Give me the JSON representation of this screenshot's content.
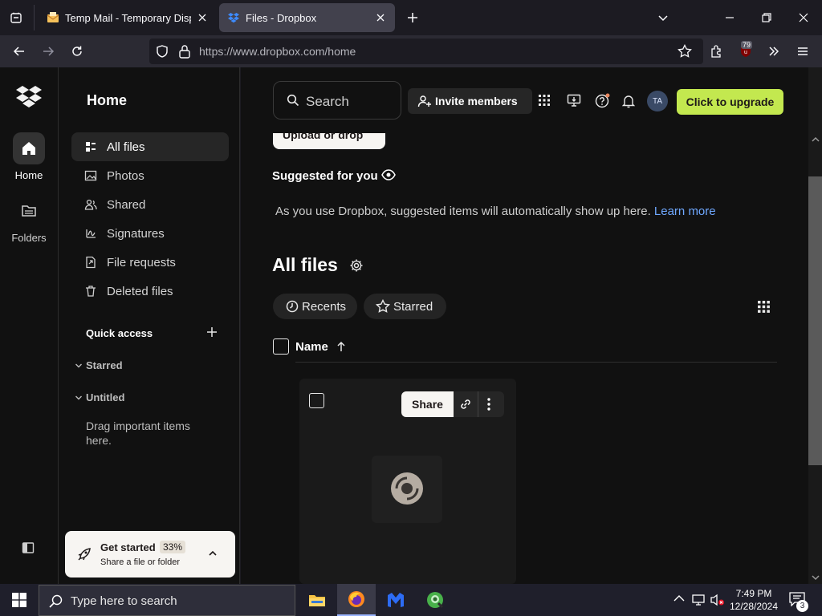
{
  "browser": {
    "tabs": [
      {
        "title": "Temp Mail - Temporary Dispos"
      },
      {
        "title": "Files - Dropbox"
      }
    ],
    "url_host": "https://www.dropbox.com",
    "url_path": "/home",
    "ext_badge": "79"
  },
  "rail": {
    "home_label": "Home",
    "folders_label": "Folders"
  },
  "sidebar": {
    "title": "Home",
    "items": [
      {
        "label": "All files",
        "icon": "files-icon"
      },
      {
        "label": "Photos",
        "icon": "photo-icon"
      },
      {
        "label": "Shared",
        "icon": "shared-icon"
      },
      {
        "label": "Signatures",
        "icon": "signature-icon"
      },
      {
        "label": "File requests",
        "icon": "file-request-icon"
      },
      {
        "label": "Deleted files",
        "icon": "trash-icon"
      }
    ],
    "quick_access": "Quick access",
    "starred": "Starred",
    "untitled": "Untitled",
    "drag_hint": "Drag important items here.",
    "get_started": {
      "title": "Get started",
      "percent": "33%",
      "subtitle": "Share a file or folder"
    }
  },
  "header": {
    "search_placeholder": "Search",
    "invite": "Invite members",
    "avatar": "TA",
    "upgrade": "Click to upgrade"
  },
  "main": {
    "upload_partial": "Upload or drop",
    "suggested_title": "Suggested for you",
    "suggested_text": "As you use Dropbox, suggested items will automatically show up here.",
    "learn_more": "Learn more",
    "all_files_title": "All files",
    "filters": [
      "Recents",
      "Starred"
    ],
    "column_name": "Name",
    "share_label": "Share"
  },
  "taskbar": {
    "search_placeholder": "Type here to search",
    "time": "7:49 PM",
    "date": "12/28/2024",
    "notif_count": "3"
  },
  "colors": {
    "accent_upgrade": "#c3e84f",
    "link": "#6fa8ff",
    "background": "#111111"
  }
}
